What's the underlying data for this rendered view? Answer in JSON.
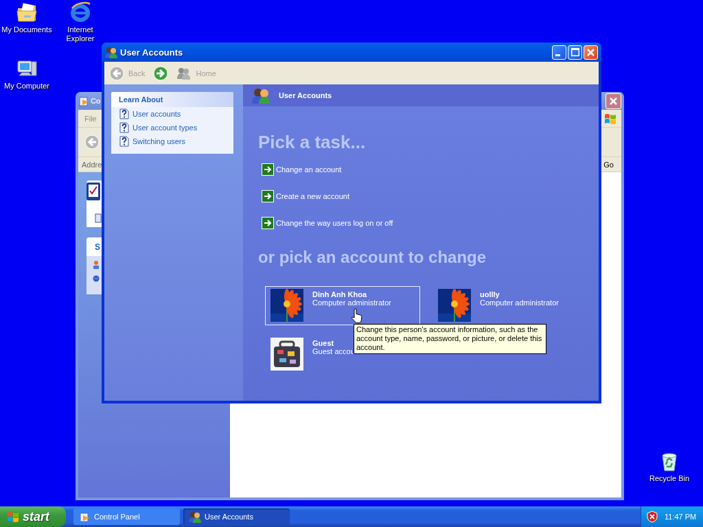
{
  "desktop_icons": [
    {
      "label": "My Documents",
      "kind": "documents"
    },
    {
      "label": "Internet Explorer",
      "kind": "browser"
    },
    {
      "label": "My Computer",
      "kind": "computer"
    },
    {
      "label": "Recycle Bin",
      "kind": "recycle"
    }
  ],
  "background_window": {
    "title": "Co",
    "menu": [
      "File"
    ],
    "address_label": "Addre",
    "go_button": "Go",
    "panel_heading": "S"
  },
  "window": {
    "title": "User Accounts",
    "toolbar": [
      {
        "kind": "back",
        "label": "Back",
        "disabled": true
      },
      {
        "kind": "forward",
        "disabled": false
      },
      {
        "kind": "home",
        "label": "Home",
        "disabled": true
      }
    ],
    "learn_about": {
      "title": "Learn About",
      "items": [
        "User accounts",
        "User account types",
        "Switching users"
      ]
    },
    "header": "User Accounts",
    "tasks_heading": "Pick a task...",
    "tasks": [
      "Change an account",
      "Create a new account",
      "Change the way users log on or off"
    ],
    "accounts_heading": "or pick an account to change",
    "accounts": [
      {
        "name": "Dinh Anh Khoa",
        "type": "Computer administrator",
        "selected": true
      },
      {
        "name": "uollly",
        "type": "Computer administrator",
        "selected": false
      },
      {
        "name": "Guest",
        "type": "Guest accou",
        "selected": false
      }
    ]
  },
  "tooltip": "Change this person's account information, such as the account type, name, password, or picture, or delete this account.",
  "taskbar": {
    "start": "start",
    "tasks": [
      {
        "label": "Control Panel",
        "kind": "control-panel",
        "selected": false
      },
      {
        "label": "User Accounts",
        "kind": "users",
        "selected": true
      }
    ],
    "clock": "11:47 PM"
  }
}
